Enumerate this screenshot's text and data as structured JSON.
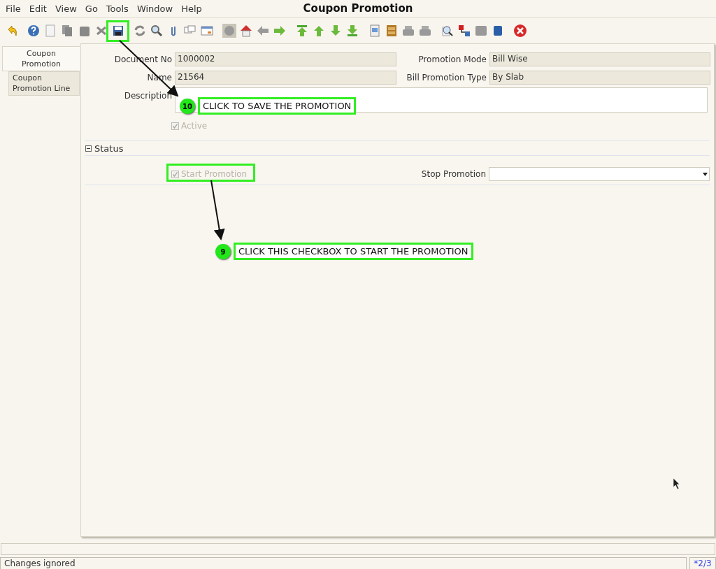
{
  "menu": [
    {
      "label": "File"
    },
    {
      "label": "Edit"
    },
    {
      "label": "View"
    },
    {
      "label": "Go"
    },
    {
      "label": "Tools"
    },
    {
      "label": "Window"
    },
    {
      "label": "Help"
    }
  ],
  "window": {
    "title": "Coupon Promotion"
  },
  "tabs": [
    {
      "label": "Coupon Promotion",
      "selected": true
    },
    {
      "label": "Coupon Promotion Line",
      "selected": false
    }
  ],
  "fields": [
    {
      "label": "Document No",
      "value": "1000002"
    },
    {
      "label": "Promotion Mode",
      "value": "Bill Wise"
    },
    {
      "label": "Name",
      "value": "21564"
    },
    {
      "label": "Bill Promotion Type",
      "value": "By Slab"
    }
  ],
  "description": {
    "label": "Description"
  },
  "active": {
    "label": "Active",
    "checked": true,
    "disabled": true
  },
  "status_section": {
    "title": "Status",
    "expanded": true,
    "start": {
      "label": "Start Promotion",
      "checked": true,
      "disabled": true
    },
    "stop": {
      "label": "Stop Promotion"
    }
  },
  "annotations": [
    {
      "number": "10",
      "text": "CLICK TO SAVE THE PROMOTION"
    },
    {
      "number": "9",
      "text": "CLICK THIS CHECKBOX TO START THE PROMOTION"
    }
  ],
  "status_bar": {
    "message": "Changes ignored",
    "record": "*2/3"
  }
}
